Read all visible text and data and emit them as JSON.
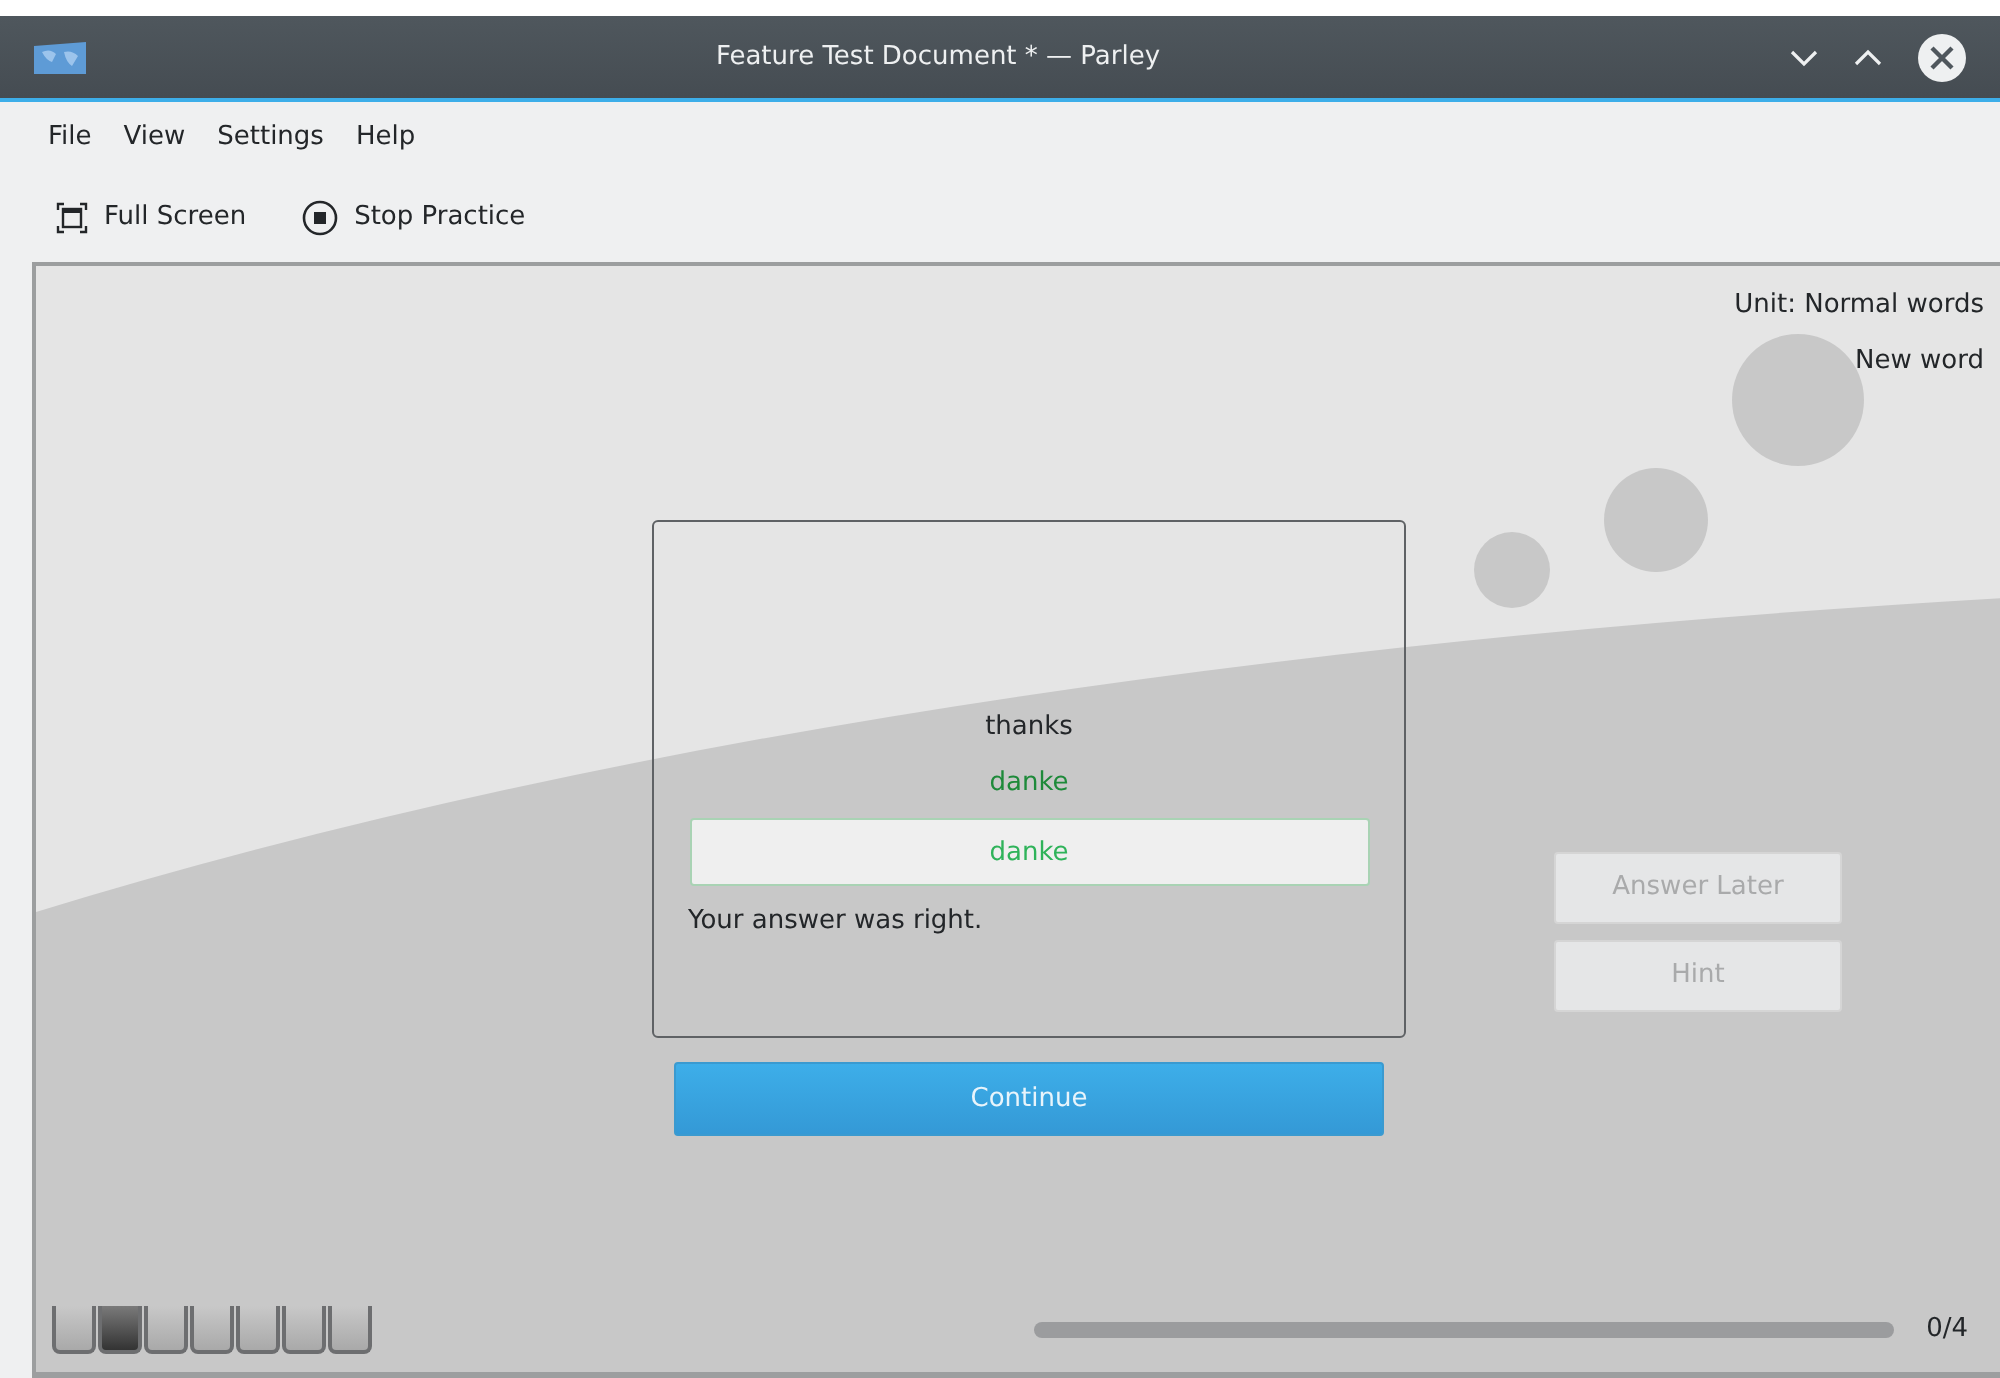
{
  "window": {
    "title": "Feature Test Document * — Parley"
  },
  "menu": [
    {
      "label": "File"
    },
    {
      "label": "View"
    },
    {
      "label": "Settings"
    },
    {
      "label": "Help"
    }
  ],
  "toolbar": [
    {
      "kind": "fullscreen",
      "label": "Full Screen"
    },
    {
      "kind": "stop",
      "label": "Stop Practice"
    }
  ],
  "practice": {
    "unit": "Unit: Normal words",
    "status": "New word",
    "question": "thanks",
    "solution": "danke",
    "answer_field": {
      "value": "danke",
      "correct": true
    },
    "feedback": "Your answer was right.",
    "continue_button": "Continue",
    "side_buttons": [
      {
        "label": "Answer Later",
        "disabled": true
      },
      {
        "label": "Hint",
        "disabled": true
      }
    ],
    "grade_tiles": [
      {
        "selected": false
      },
      {
        "selected": true
      },
      {
        "selected": false
      },
      {
        "selected": false
      },
      {
        "selected": false
      },
      {
        "selected": false
      },
      {
        "selected": false
      }
    ],
    "progress": {
      "level": 0,
      "reading": "0/4"
    }
  }
}
